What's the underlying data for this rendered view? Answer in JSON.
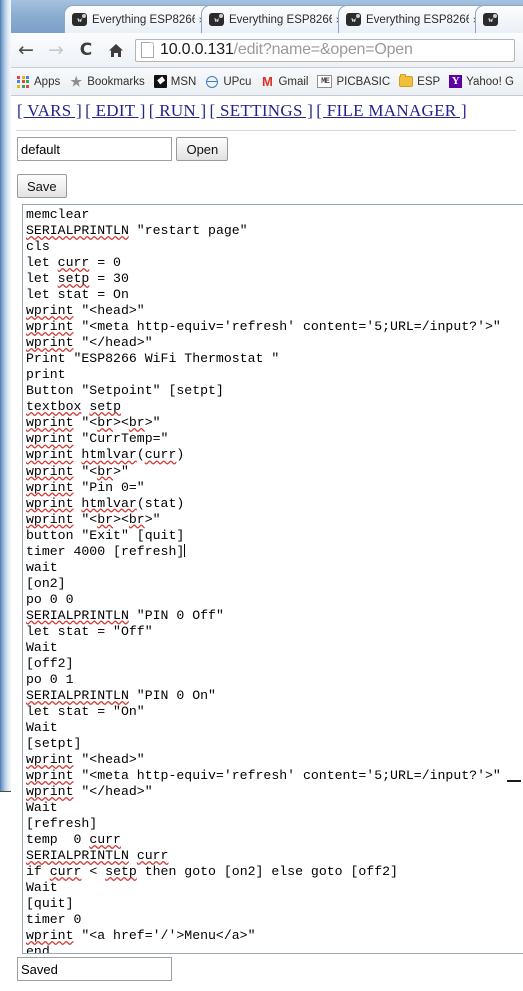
{
  "browser": {
    "tabs": [
      {
        "title": "Everything ESP8266 -",
        "favicon": "w-logo-icon",
        "close_label": "×"
      },
      {
        "title": "Everything ESP8266 -",
        "favicon": "w-logo-icon",
        "close_label": "×"
      },
      {
        "title": "Everything ESP8266 -",
        "favicon": "w-logo-icon",
        "close_label": "×"
      },
      {
        "title": "",
        "favicon": "w-logo-icon",
        "close_label": ""
      }
    ],
    "nav": {
      "back": "←",
      "forward": "→",
      "reload": "C",
      "home": "home-icon"
    },
    "address": {
      "host": "10.0.0.131",
      "path": "/edit?name=&open=Open",
      "full": "10.0.0.131/edit?name=&open=Open"
    },
    "bookmarks": [
      {
        "label": "Apps",
        "icon": "apps-grid-icon"
      },
      {
        "label": "Bookmarks",
        "icon": "star-icon"
      },
      {
        "label": "MSN",
        "icon": "msn-icon"
      },
      {
        "label": "UPcu",
        "icon": "upcu-icon"
      },
      {
        "label": "Gmail",
        "icon": "gmail-icon"
      },
      {
        "label": "PICBASIC",
        "icon": "picbasic-icon"
      },
      {
        "label": "ESP",
        "icon": "folder-icon"
      },
      {
        "label": "Yahoo! G",
        "icon": "yahoo-icon"
      }
    ]
  },
  "page": {
    "nav_links": [
      "[ VARS ]",
      "[ EDIT ]",
      "[ RUN ]",
      "[ SETTINGS ]",
      "[ FILE MANAGER ]"
    ],
    "filename_field": {
      "value": "default",
      "placeholder": ""
    },
    "open_button": "Open",
    "save_button": "Save",
    "status_field": {
      "value": "Saved",
      "placeholder": ""
    },
    "editor": {
      "lines": [
        "memclear",
        "SERIALPRINTLN \"restart page\"",
        "cls",
        "let curr = 0",
        "let setp = 30",
        "let stat = On",
        "wprint \"<head>\"",
        "wprint \"<meta http-equiv='refresh' content='5;URL=/input?'>\"",
        "wprint \"</head>\"",
        "Print \"ESP8266 WiFi Thermostat \"",
        "print",
        "Button \"Setpoint\" [setpt]",
        "textbox setp",
        "wprint \"<br><br>\"",
        "wprint \"CurrTemp=\"",
        "wprint htmlvar(curr)",
        "wprint \"<br>\"",
        "wprint \"Pin 0=\"",
        "wprint htmlvar(stat)",
        "wprint \"<br><br>\"",
        "button \"Exit\" [quit]",
        "timer 4000 [refresh]",
        "wait",
        "[on2]",
        "po 0 0",
        "SERIALPRINTLN \"PIN 0 Off\"",
        "let stat = \"Off\"",
        "Wait",
        "[off2]",
        "po 0 1",
        "SERIALPRINTLN \"PIN 0 On\"",
        "let stat = \"On\"",
        "Wait",
        "[setpt]",
        "wprint \"<head>\"",
        "wprint \"<meta http-equiv='refresh' content='5;URL=/input?'>\"",
        "wprint \"</head>\"",
        "Wait",
        "[refresh]",
        "temp  0 curr",
        "SERIALPRINTLN curr",
        "if curr < setp then goto [on2] else goto [off2]",
        "Wait",
        "[quit]",
        "timer 0",
        "wprint \"<a href='/'>Menu</a>\"",
        "end"
      ],
      "caret_line_index": 21,
      "misspelled_words": [
        "wprint",
        "textbox",
        "setp",
        "htmlvar",
        "curr",
        "br",
        "SERIALPRINTLN"
      ]
    }
  },
  "colors": {
    "link": "#23238e",
    "chrome_blue": "#8fb2d4",
    "spellcheck_red": "#d63b3b",
    "folder_yellow": "#f0c03a",
    "yahoo_purple": "#5c00a3",
    "gmail_red": "#d93025"
  }
}
